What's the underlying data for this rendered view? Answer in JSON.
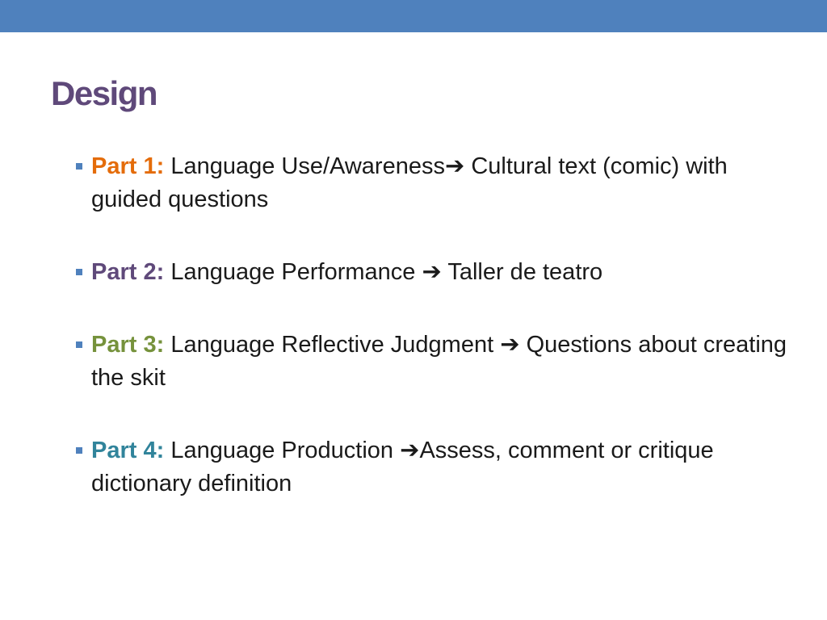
{
  "theme": {
    "top_bar_color": "#4f81bd",
    "title_color": "#5f497a",
    "bullet_marker_color": "#4f81bd"
  },
  "slide": {
    "title": "Design",
    "items": [
      {
        "label": "Part 1:",
        "label_color": "#e46c0a",
        "pre_arrow": "Language Use/Awareness",
        "arrow_icon": "right-arrow-icon",
        "arrow_glyph": "➔",
        "post_arrow": " Cultural text (comic) with guided questions"
      },
      {
        "label": "Part 2:",
        "label_color": "#5f497a",
        "pre_arrow": "Language Performance ",
        "arrow_icon": "right-arrow-icon",
        "arrow_glyph": "➔",
        "post_arrow": " Taller de teatro"
      },
      {
        "label": "Part 3:",
        "label_color": "#76923c",
        "pre_arrow": "Language Reflective Judgment ",
        "arrow_icon": "right-arrow-icon",
        "arrow_glyph": "➔",
        "post_arrow": " Questions about creating the skit"
      },
      {
        "label": "Part 4:",
        "label_color": "#31849b",
        "pre_arrow": "Language Production ",
        "arrow_icon": "right-arrow-icon",
        "arrow_glyph": "➔",
        "post_arrow": "Assess, comment or critique dictionary definition"
      }
    ]
  }
}
